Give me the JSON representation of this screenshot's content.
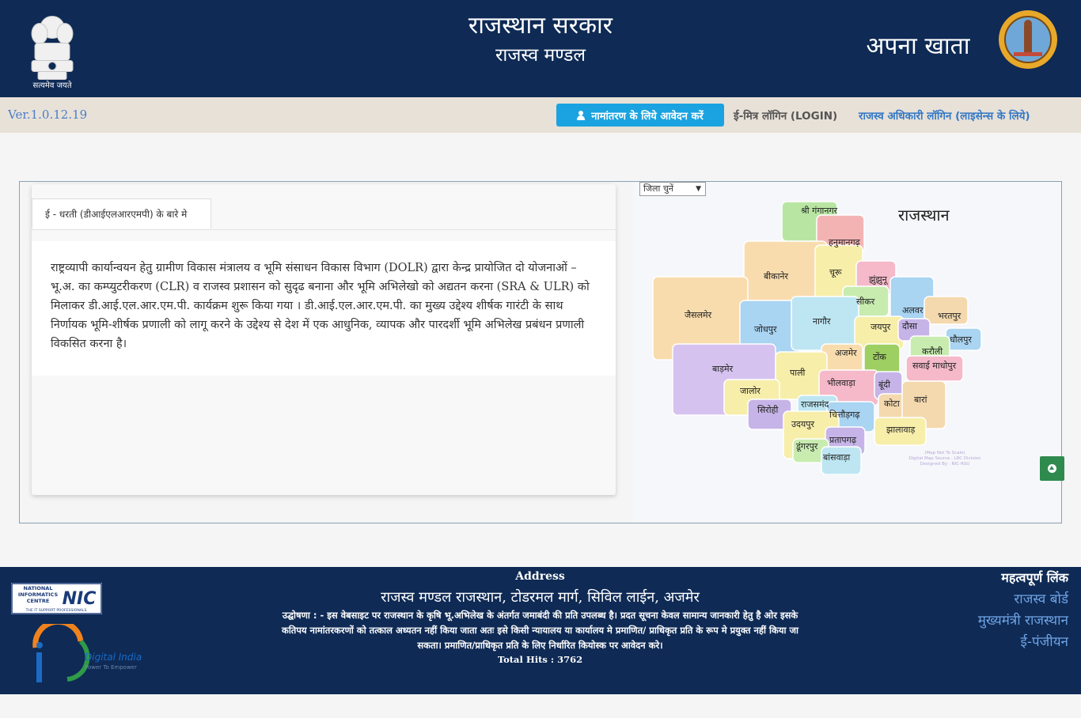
{
  "header": {
    "emblem_caption": "सत्यमेव जयते",
    "gov_title": "राजस्थान सरकार",
    "gov_subtitle": "राजस्व मण्डल",
    "app_title": "अपना खाता"
  },
  "navbar": {
    "version": "Ver.1.0.12.19",
    "apply_button": "नामांतरण के लिये आवेदन करें",
    "emitra_login": "ई-मित्र लॉगिन (LOGIN)",
    "officer_login": "राजस्व अधिकारी लॉगिन (लाइसेन्स के लिये)"
  },
  "card": {
    "tab_label": "ई - धरती (डीआईएलआरएमपी) के बारे मे",
    "description": "राष्ट्रव्यापी कार्यान्वयन हेतु ग्रामीण विकास मंत्रालय व भूमि संसाधन विकास विभाग (DOLR) द्वारा केन्द्र प्रायोजित दो योजनाओं – भू.अ. का कम्प्युटरीकरण (CLR) व राजस्व प्रशासन को सुदृढ बनाना और भूमि अभिलेखो को अद्यतन करना (SRA & ULR) को मिलाकर डी.आई.एल.आर.एम.पी. कार्यक्रम शुरू किया गया । डी.आई.एल.आर.एम.पी. का मुख्य उद्देश्य शीर्षक गारंटी के साथ निर्णायक भूमि-शीर्षक प्रणाली को लागू करने के उद्देश्य से देश में एक आधुनिक, व्यापक और पारदर्शी भूमि अभिलेख प्रबंधन प्रणाली विकसित करना है।"
  },
  "map": {
    "select_label": "जिला चुनें",
    "title": "राजस्थान",
    "note_lines": [
      "(Map Not To Scale)",
      "Digital Map Source : LRC Division",
      "Designed By : NIC-RSU"
    ],
    "districts": [
      {
        "name": "श्री गंगानगर",
        "color": "#b8e6a2"
      },
      {
        "name": "हनुमानगढ़",
        "color": "#f4b3b3"
      },
      {
        "name": "बीकानेर",
        "color": "#f9dcae"
      },
      {
        "name": "चूरू",
        "color": "#f7eeaa"
      },
      {
        "name": "झुंझुनू",
        "color": "#f5b9c9"
      },
      {
        "name": "सीकर",
        "color": "#c8ecb0"
      },
      {
        "name": "अलवर",
        "color": "#a9d4f2"
      },
      {
        "name": "भरतपुर",
        "color": "#f4d9ae"
      },
      {
        "name": "जैसलमेर",
        "color": "#f9dcae"
      },
      {
        "name": "जोधपुर",
        "color": "#a9d4f2"
      },
      {
        "name": "नागौर",
        "color": "#bde6f2"
      },
      {
        "name": "जयपुर",
        "color": "#f7eeaa"
      },
      {
        "name": "दौसा",
        "color": "#c6b4e8"
      },
      {
        "name": "धौलपुर",
        "color": "#a9d4f2"
      },
      {
        "name": "करौली",
        "color": "#c8ecb0"
      },
      {
        "name": "अजमेर",
        "color": "#f9dcae"
      },
      {
        "name": "टोंक",
        "color": "#9ecf62"
      },
      {
        "name": "सवाई माधोपुर",
        "color": "#f5b9c9"
      },
      {
        "name": "बाड़मेर",
        "color": "#d6c2ef"
      },
      {
        "name": "पाली",
        "color": "#f7eeaa"
      },
      {
        "name": "भीलवाड़ा",
        "color": "#f5b9c9"
      },
      {
        "name": "बूंदी",
        "color": "#c6b4e8"
      },
      {
        "name": "जालोर",
        "color": "#f7eeaa"
      },
      {
        "name": "सिरोही",
        "color": "#c6b4e8"
      },
      {
        "name": "राजसमंद",
        "color": "#bde6f2"
      },
      {
        "name": "चित्तौड़गढ़",
        "color": "#a9d4f2"
      },
      {
        "name": "कोटा",
        "color": "#f4d9ae"
      },
      {
        "name": "बारां",
        "color": "#f4d9ae"
      },
      {
        "name": "झालावाड़",
        "color": "#f7eeaa"
      },
      {
        "name": "उदयपुर",
        "color": "#f7eeaa"
      },
      {
        "name": "प्रतापगढ़",
        "color": "#c6b4e8"
      },
      {
        "name": "डूंगरपुर",
        "color": "#c8ecb0"
      },
      {
        "name": "बांसवाड़ा",
        "color": "#bde6f2"
      }
    ]
  },
  "footer": {
    "address_heading": "Address",
    "address": "राजस्व मण्डल राजस्थान, टोडरमल मार्ग, सिविल लाईन, अजमेर",
    "disclaimer": "उद्घोषणा : - इस वेबसाइट पर राजस्थान के कृषि भू.अभिलेख के अंतर्गत जमाबंदी की प्रति उपलब्ध है। प्रदत सूचना केवल सामान्य जानकारी हेतु है ओर इसके कतिपय नामांतरकरणों को तत्काल अध्यतन नहीं किया जाता अतः इसे किसी न्यायालय या कार्यालय मे प्रमाणित/ प्राधिकृत प्रति के रूप मे प्रयुक्त नहीं किया जा सकता। प्रमाणित/प्राधिकृत प्रति के लिए निर्धारित कियोस्क पर आवेदन करे।",
    "total_hits": "Total Hits : 3762",
    "links_heading": "महत्वपूर्ण लिंक",
    "links": [
      "राजस्व बोर्ड",
      "मुख्यमंत्री राजस्थान",
      "ई-पंजीयन"
    ],
    "nic_text": [
      "NATIONAL",
      "INFORMATICS",
      "CENTRE",
      "THE IT SUPPORT PROFESSIONALS"
    ],
    "nic_mark": "NIC",
    "digital_india_title": "Digital India",
    "digital_india_tagline": "Power To Empower"
  },
  "colors": {
    "header_bg": "#0e2a55",
    "navbar_bg": "#e8e1d8",
    "apply_button_bg": "#1aa3e0",
    "link_blue": "#3478c6",
    "scroll_top_bg": "#2f8a4e"
  }
}
